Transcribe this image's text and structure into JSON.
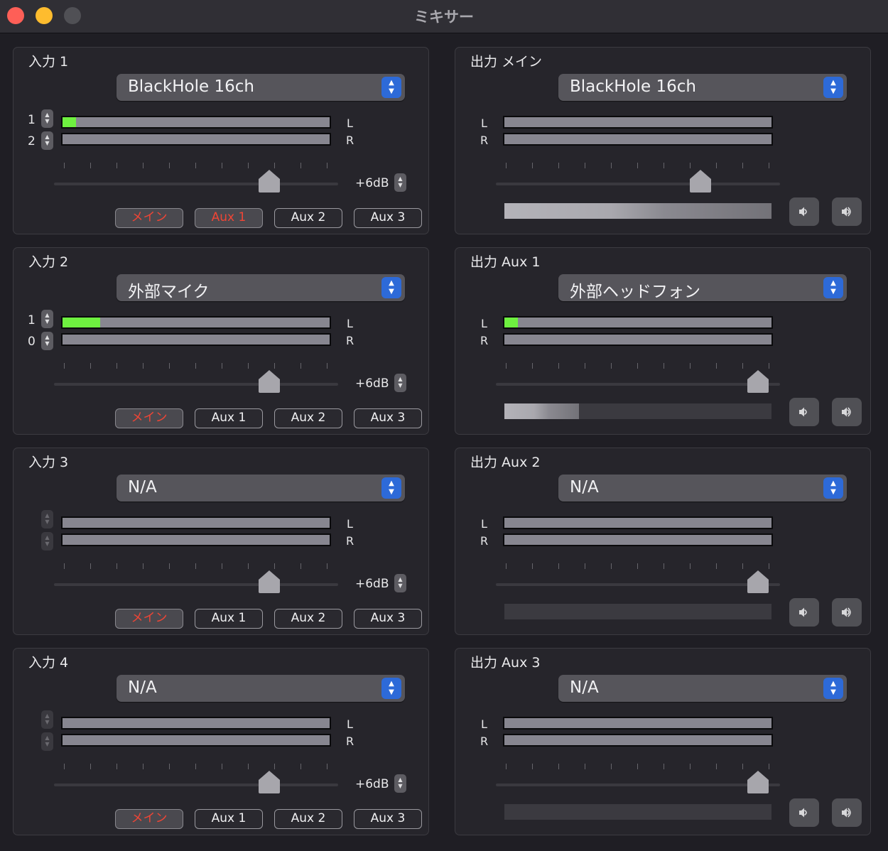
{
  "window": {
    "title": "ミキサー"
  },
  "colors": {
    "active_route": "#f04535",
    "meter_signal": "#6ef040",
    "select_accent": "#2d6ad8"
  },
  "inputs": [
    {
      "title": "入力 1",
      "device": "BlackHole 16ch",
      "channels": [
        "1",
        "2"
      ],
      "meter_levels": [
        0.05,
        0.0
      ],
      "fader_position": 0.78,
      "gain_label": "+6dB",
      "routes": [
        {
          "label": "メイン",
          "active": true
        },
        {
          "label": "Aux 1",
          "active": true
        },
        {
          "label": "Aux 2",
          "active": false
        },
        {
          "label": "Aux 3",
          "active": false
        }
      ]
    },
    {
      "title": "入力 2",
      "device": "外部マイク",
      "channels": [
        "1",
        "0"
      ],
      "meter_levels": [
        0.14,
        0.0
      ],
      "fader_position": 0.78,
      "gain_label": "+6dB",
      "routes": [
        {
          "label": "メイン",
          "active": true
        },
        {
          "label": "Aux 1",
          "active": false
        },
        {
          "label": "Aux 2",
          "active": false
        },
        {
          "label": "Aux 3",
          "active": false
        }
      ]
    },
    {
      "title": "入力 3",
      "device": "N/A",
      "channels": [
        "",
        ""
      ],
      "meter_levels": [
        0.0,
        0.0
      ],
      "fader_position": 0.78,
      "gain_label": "+6dB",
      "routes": [
        {
          "label": "メイン",
          "active": true
        },
        {
          "label": "Aux 1",
          "active": false
        },
        {
          "label": "Aux 2",
          "active": false
        },
        {
          "label": "Aux 3",
          "active": false
        }
      ]
    },
    {
      "title": "入力 4",
      "device": "N/A",
      "channels": [
        "",
        ""
      ],
      "meter_levels": [
        0.0,
        0.0
      ],
      "fader_position": 0.78,
      "gain_label": "+6dB",
      "routes": [
        {
          "label": "メイン",
          "active": true
        },
        {
          "label": "Aux 1",
          "active": false
        },
        {
          "label": "Aux 2",
          "active": false
        },
        {
          "label": "Aux 3",
          "active": false
        }
      ]
    }
  ],
  "outputs": [
    {
      "title": "出力 メイン",
      "device": "BlackHole 16ch",
      "meter_levels": [
        0.0,
        0.0
      ],
      "fader_position": 0.74,
      "level": 1.0
    },
    {
      "title": "出力 Aux 1",
      "device": "外部ヘッドフォン",
      "meter_levels": [
        0.05,
        0.0
      ],
      "fader_position": 0.96,
      "level": 0.28
    },
    {
      "title": "出力 Aux 2",
      "device": "N/A",
      "meter_levels": [
        0.0,
        0.0
      ],
      "fader_position": 0.96,
      "level": 0.0
    },
    {
      "title": "出力 Aux 3",
      "device": "N/A",
      "meter_levels": [
        0.0,
        0.0
      ],
      "fader_position": 0.96,
      "level": 0.0
    }
  ],
  "labels": {
    "left": "L",
    "right": "R"
  },
  "icons": {
    "volume_down": "speaker-low-icon",
    "volume_up": "speaker-high-icon"
  }
}
